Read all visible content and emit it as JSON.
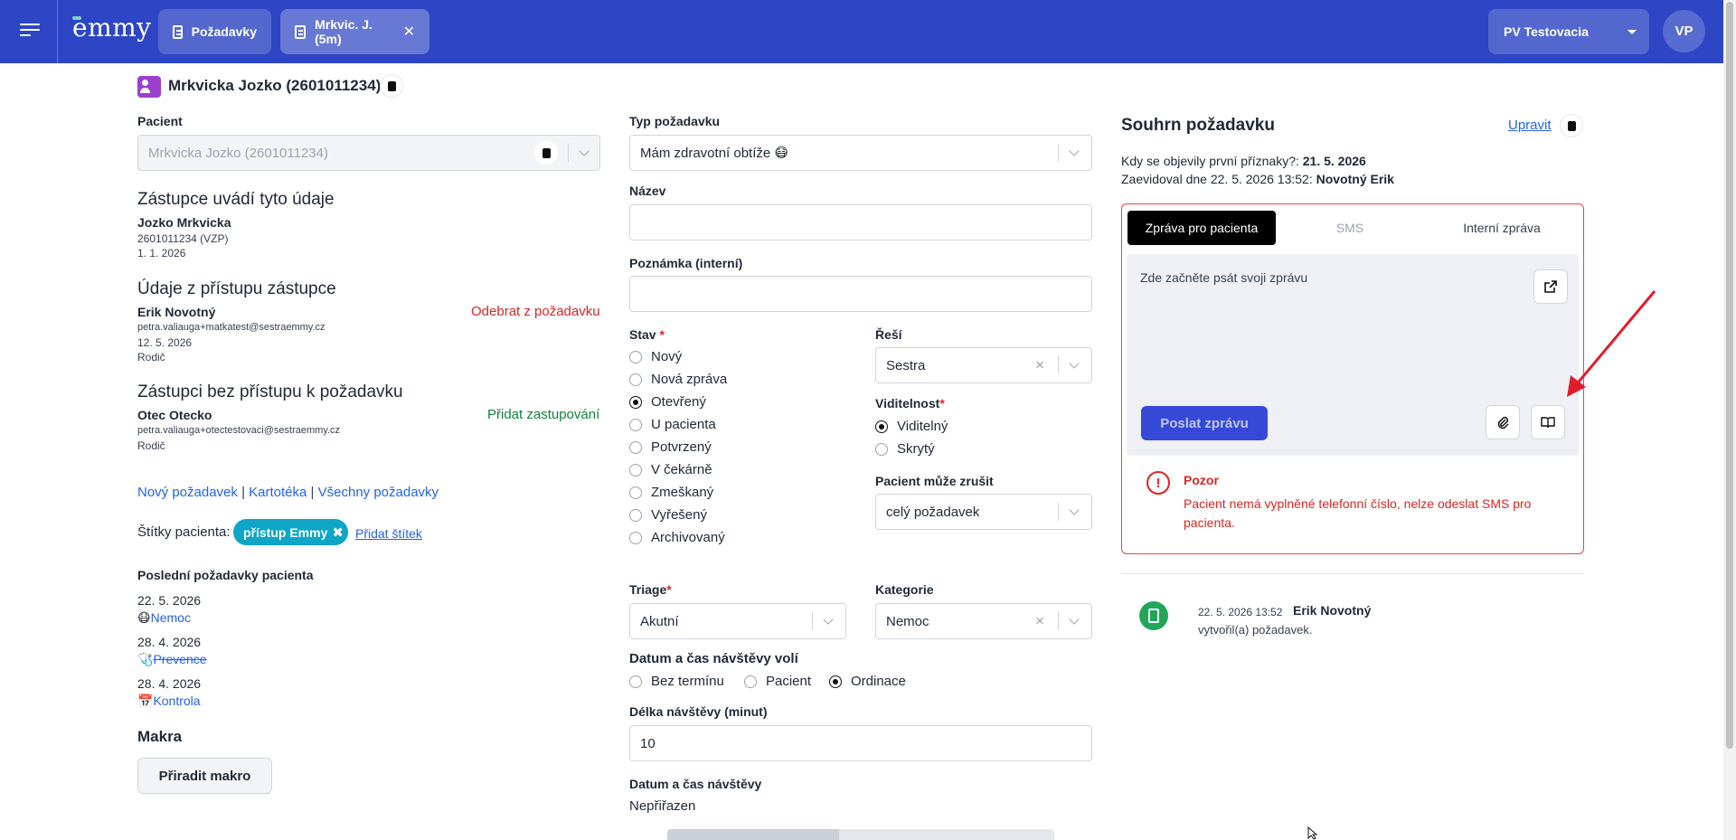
{
  "topbar": {
    "logo": "emmy",
    "tabs": [
      {
        "label": "Požadavky"
      },
      {
        "label": "Mrkvic. J. (5m)"
      }
    ],
    "workspace": "PV Testovacia",
    "avatar": "VP"
  },
  "header": {
    "title": "Mrkvicka Jozko (2601011234)"
  },
  "left": {
    "patient_label": "Pacient",
    "patient_value": "Mrkvicka Jozko (2601011234)",
    "rep_heading": "Zástupce uvádí tyto údaje",
    "rep_name": "Jozko Mrkvicka",
    "rep_id": "2601011234 (VZP)",
    "rep_date": "1. 1. 2026",
    "access_heading": "Údaje z přístupu zástupce",
    "access_name": "Erik Novotný",
    "access_email": "petra.valiauga+matkatest@sestraemmy.cz",
    "access_date": "12. 5. 2026",
    "access_role": "Rodič",
    "remove_link": "Odebrat z požadavku",
    "noaccess_heading": "Zástupci bez přístupu k požadavku",
    "noaccess_name": "Otec Otecko",
    "noaccess_email": "petra.valiauga+otectestovaci@sestraemmy.cz",
    "noaccess_role": "Rodič",
    "add_rep_link": "Přidat zastupování",
    "links": [
      "Nový požadavek",
      "Kartotéka",
      "Všechny požadavky"
    ],
    "link_sep": "|",
    "tags_label": "Štítky pacienta:",
    "tag": "přístup Emmy",
    "add_tag": "Přidat štítek",
    "recent_heading": "Poslední požadavky pacienta",
    "recent": [
      {
        "date": "22. 5. 2026",
        "icon": "😷",
        "label": "Nemoc"
      },
      {
        "date": "28. 4. 2026",
        "icon": "🩺",
        "label": "Prevence"
      },
      {
        "date": "28. 4. 2026",
        "icon": "📅",
        "label": "Kontrola"
      }
    ],
    "macros_heading": "Makra",
    "macro_button": "Přiradit makro"
  },
  "middle": {
    "type_label": "Typ požadavku",
    "type_value": "Mám zdravotní obtíže 😷",
    "name_label": "Název",
    "name_value": "",
    "note_label": "Poznámka (interní)",
    "note_value": "",
    "state_label": "Stav",
    "states": [
      "Nový",
      "Nová zpráva",
      "Otevřený",
      "U pacienta",
      "Potvrzený",
      "V čekárně",
      "Zmeškaný",
      "Vyřešený",
      "Archivovaný"
    ],
    "state_selected": "Otevřený",
    "resolver_label": "Řeší",
    "resolver_value": "Sestra",
    "visibility_label": "Viditelnost",
    "visibility_options": [
      "Viditelný",
      "Skrytý"
    ],
    "visibility_selected": "Viditelný",
    "cancel_label": "Pacient může zrušit",
    "cancel_value": "celý požadavek",
    "triage_label": "Triage",
    "triage_value": "Akutní",
    "category_label": "Kategorie",
    "category_value": "Nemoc",
    "visit_choice_label": "Datum a čas návštěvy volí",
    "visit_choices": [
      "Bez termínu",
      "Pacient",
      "Ordinace"
    ],
    "visit_choice_selected": "Ordinace",
    "duration_label": "Délka návštěvy (minut)",
    "duration_value": "10",
    "datetime_label": "Datum a čas návštěvy",
    "datetime_value": "Nepřiřazen",
    "required_mark": "*"
  },
  "right": {
    "summary_heading": "Souhrn požadavku",
    "edit_link": "Upravit",
    "symptoms_label": "Kdy se objevily první příznaky?:",
    "symptoms_value": "21. 5. 2026",
    "recorded_label": "Zaevidoval dne 22. 5. 2026 13:52:",
    "recorded_by": "Novotný Erik",
    "tabs": [
      "Zpráva pro pacienta",
      "SMS",
      "Interní zpráva"
    ],
    "compose_placeholder": "Zde začněte psát svoji zprávu",
    "send_button": "Poslat zprávu",
    "warning_title": "Pozor",
    "warning_text": "Pacient nemá vyplněné telefonní číslo, nelze odeslat SMS pro pacienta.",
    "history": {
      "time": "22. 5. 2026 13:52",
      "author": "Erik Novotný",
      "text": "vytvořil(a) požadavek."
    }
  },
  "colors": {
    "primary": "#2e46c5",
    "danger": "#dc2626",
    "success": "#15803d",
    "tag": "#0ea5c6"
  }
}
